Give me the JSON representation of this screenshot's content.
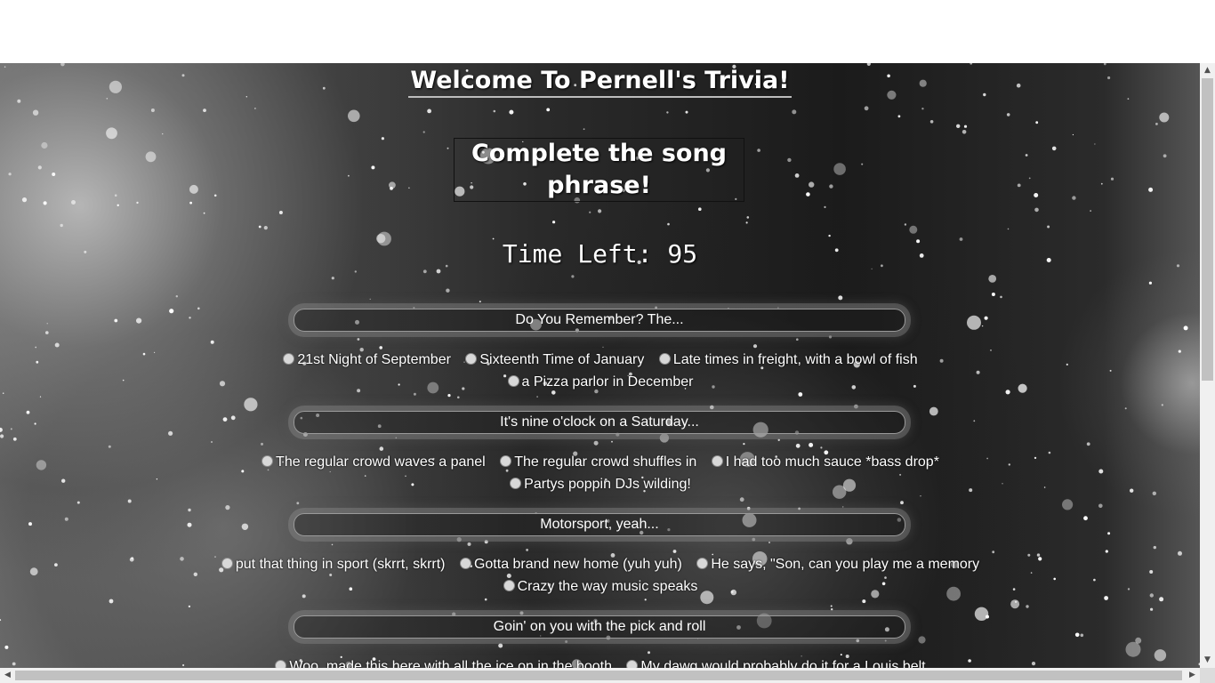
{
  "page": {
    "title": "Welcome To Pernell's Trivia!",
    "subtitle": "Complete the song phrase!",
    "timer_text": "Time Left: 95"
  },
  "questions": [
    {
      "prompt": "Do You Remember? The...",
      "options": [
        "21st Night of September",
        "Sixteenth Time of January",
        "Late times in freight, with a bowl of fish",
        "a Pizza parlor in December"
      ]
    },
    {
      "prompt": "It's nine o'clock on a Saturday...",
      "options": [
        "The regular crowd waves a panel",
        "The regular crowd shuffles in",
        "I had too much sauce *bass drop*",
        "Partys poppin DJs wilding!"
      ]
    },
    {
      "prompt": "Motorsport, yeah...",
      "options": [
        "put that thing in sport (skrrt, skrrt)",
        "Gotta brand new home (yuh yuh)",
        "He says, \"Son, can you play me a memory",
        "Crazy the way music speaks"
      ]
    },
    {
      "prompt": "Goin' on you with the pick and roll",
      "options": [
        "Woo, made this here with all the ice on in the booth",
        "My dawg would probably do it for a Louis belt"
      ]
    }
  ],
  "colors": {
    "text": "#ffffff",
    "scrollbar_track": "#f0f0f0",
    "scrollbar_thumb": "#c1c1c1"
  },
  "icons": {
    "scroll_up": "▲",
    "scroll_down": "▼",
    "scroll_left": "◀",
    "scroll_right": "▶"
  }
}
